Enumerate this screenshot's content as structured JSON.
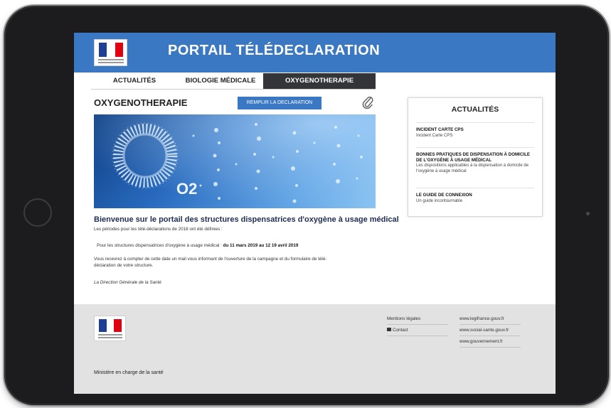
{
  "header": {
    "title": "PORTAIL TÉLÉDECLARATION"
  },
  "nav": {
    "tabs": [
      "ACTUALITÉS",
      "BIOLOGIE MÉDICALE",
      "OXYGENOTHERAPIE"
    ],
    "active": "OXYGENOTHERAPIE"
  },
  "main": {
    "title": "OXYGENOTHERAPIE",
    "fill_button": "REMPLIR LA DECLARATION",
    "hero_label": "O2",
    "welcome": "Bienvenue sur le portail des structures dispensatrices d'oxygène à usage médical",
    "p1": "Les périodes pour les télé-déclarations de 2018 ont été définies :",
    "p2_prefix": "Pour les structures dispensatrices d'oxygène à usage médical : ",
    "p2_dates": "du 11 mars 2019 au 12 19 avril 2019",
    "p3_line1": "Vous recevrez à compter de cette date un mail vous informant de l'ouverture de la campagne et du formulaire de télé-",
    "p3_line2": "déclaration de votre structure.",
    "signature": "La Direction Générale de la Santé"
  },
  "sidebar": {
    "title": "ACTUALITÉS",
    "items": [
      {
        "heading": "INCIDENT CARTE CPS",
        "desc": "Incident Carte CPS"
      },
      {
        "heading": "BONNES PRATIQUES DE DISPENSATION À DOMICILE DE L'OXYGÈNE À USAGE MÉDICAL",
        "desc": "Les dispositions applicables à la dispensation à domicile de l'oxygène à usage médical"
      },
      {
        "heading": "LE GUIDE DE CONNEXION",
        "desc": "Un guide incontournable"
      }
    ]
  },
  "footer": {
    "ministry": "Ministère en charge de la santé",
    "links_left": [
      "Mentions légales",
      "Contact"
    ],
    "links_right": [
      "www.legifrance.gouv.fr",
      "www.social-sante.gouv.fr",
      "www.gouvernement.fr"
    ]
  },
  "colors": {
    "brand_blue": "#3b78c4",
    "active_tab": "#333538",
    "footer_bg": "#e2e2e2",
    "device": "#1c1c1e"
  },
  "icons": [
    "paperclip-icon",
    "mail-icon",
    "marianne-logo"
  ]
}
